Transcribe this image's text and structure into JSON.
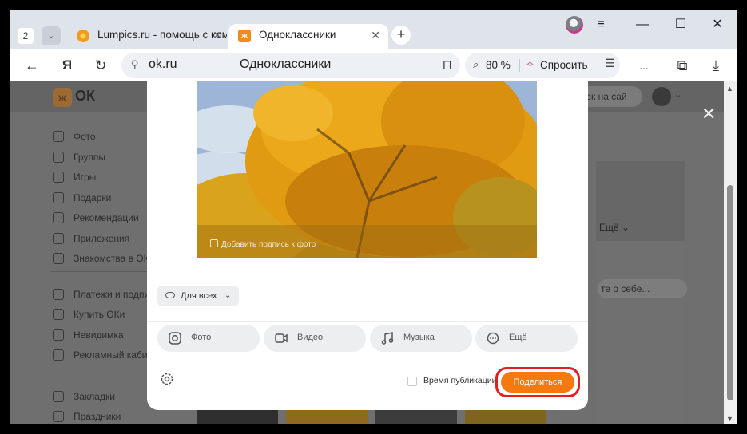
{
  "browser": {
    "tab_count": "2",
    "tabs": [
      {
        "title": "Lumpics.ru - помощь с ком"
      },
      {
        "title": "Одноклассники"
      }
    ],
    "address": {
      "host": "ok.ru",
      "page_title": "Одноклассники"
    },
    "zoom": "80 %",
    "ask_label": "Спросить",
    "more_label": "..."
  },
  "ok_page": {
    "logo_text": "ОК",
    "search_placeholder": "ск на сай",
    "sidebar": [
      {
        "label": "Фото",
        "icon": "camera-icon"
      },
      {
        "label": "Группы",
        "icon": "groups-icon"
      },
      {
        "label": "Игры",
        "icon": "gamepad-icon"
      },
      {
        "label": "Подарки",
        "icon": "gift-icon"
      },
      {
        "label": "Рекомендации",
        "icon": "compass-icon"
      },
      {
        "label": "Приложения",
        "icon": "apps-icon"
      },
      {
        "label": "Знакомства в ОК",
        "icon": "dating-icon"
      },
      {
        "label": "Платежи и подпис",
        "icon": "wallet-icon"
      },
      {
        "label": "Купить ОКи",
        "icon": "coin-icon"
      },
      {
        "label": "Невидимка",
        "icon": "invisible-icon"
      },
      {
        "label": "Рекламный кабин",
        "icon": "ads-icon"
      },
      {
        "label": "Закладки",
        "icon": "bookmark-icon"
      },
      {
        "label": "Праздники",
        "icon": "celebration-icon"
      }
    ],
    "right_more": "Ещё",
    "right_about_placeholder": "те о себе..."
  },
  "modal": {
    "photo_caption": "Добавить подпись к фото",
    "audience": "Для всех",
    "attachments": [
      {
        "label": "Фото",
        "icon": "camera-icon"
      },
      {
        "label": "Видео",
        "icon": "video-icon"
      },
      {
        "label": "Музыка",
        "icon": "music-icon"
      },
      {
        "label": "Ещё",
        "icon": "more-icon"
      }
    ],
    "publish_time_label": "Время публикации",
    "share_label": "Поделиться"
  },
  "colors": {
    "accent": "#f47a10",
    "highlight": "#e02020"
  }
}
